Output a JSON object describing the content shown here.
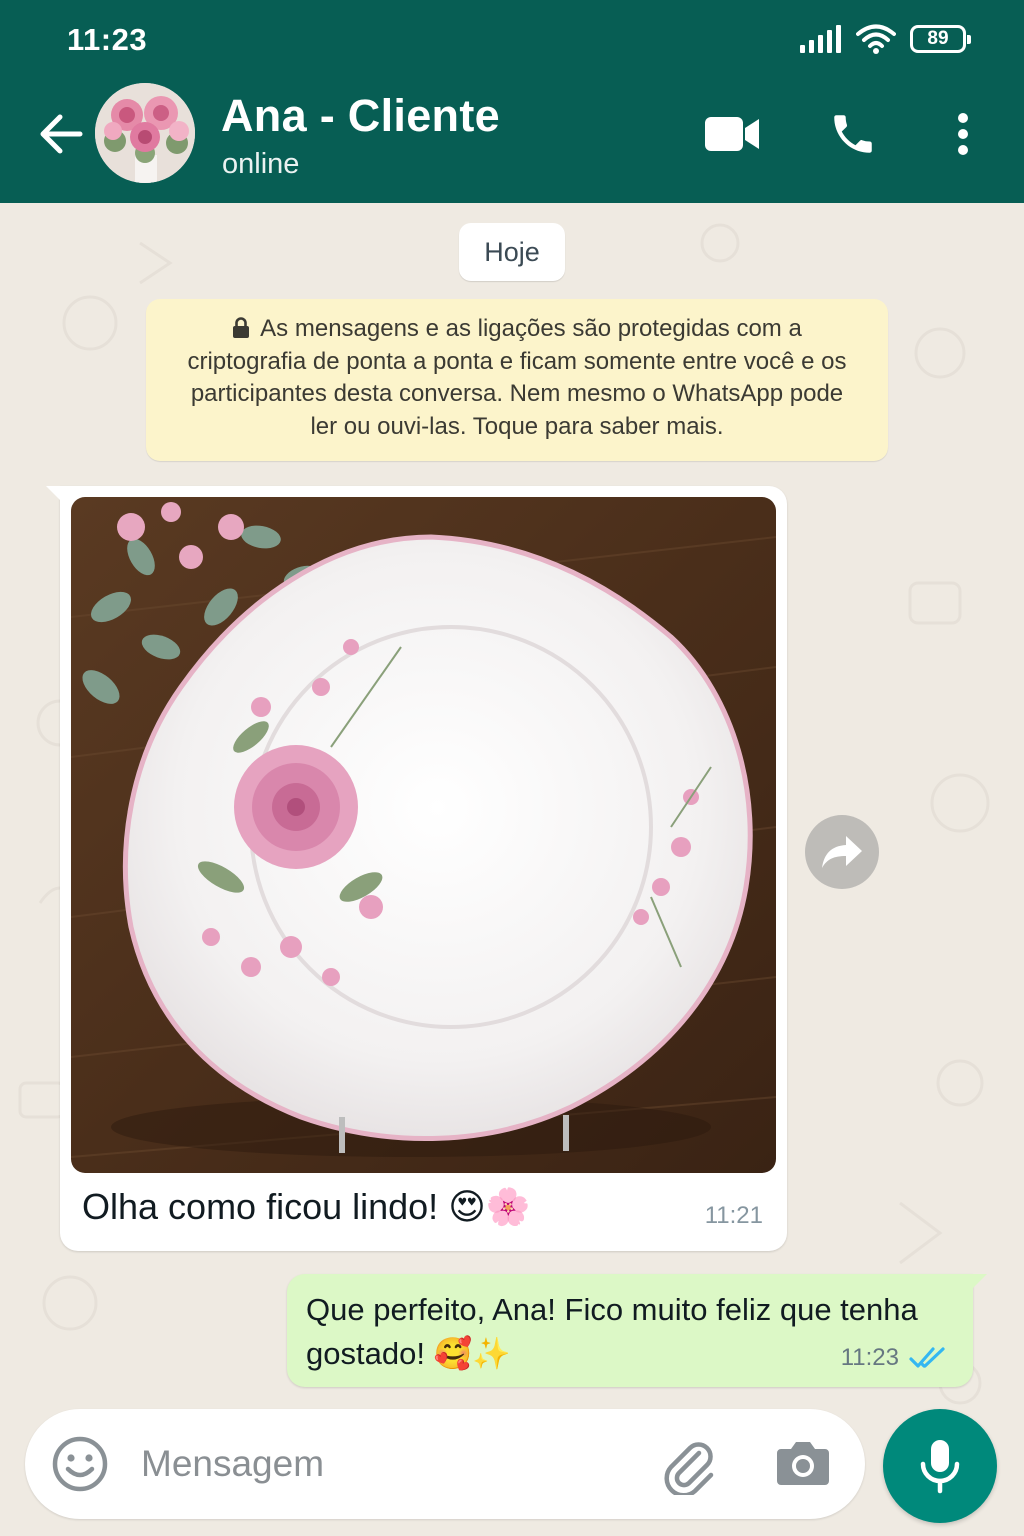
{
  "status_bar": {
    "time": "11:23",
    "battery": "89"
  },
  "header": {
    "contact_name": "Ana - Cliente",
    "contact_status": "online",
    "icons": [
      "back-arrow-icon",
      "video-call-icon",
      "phone-icon",
      "more-vert-icon"
    ]
  },
  "chat": {
    "date_chip": "Hoje",
    "encryption_notice": "As mensagens e as ligações são protegidas com a criptografia de ponta a ponta e ficam somente entre você e os participantes desta conversa. Nem mesmo o WhatsApp pode ler ou ouvi-las. Toque para saber mais.",
    "messages": [
      {
        "direction": "incoming",
        "type": "image",
        "image_description": "white scalloped porcelain plate with pink floral pattern on wooden table",
        "text": "Olha como ficou lindo! 😍🌸",
        "time": "11:21"
      },
      {
        "direction": "outgoing",
        "type": "text",
        "text": "Que perfeito, Ana! Fico muito feliz que tenha gostado! 🥰✨",
        "time": "11:23",
        "read": true
      }
    ]
  },
  "composer": {
    "placeholder": "Mensagem"
  },
  "colors": {
    "header": "#075e54",
    "chat_background": "#efeae2",
    "outgoing_bubble": "#dcf8c6",
    "notice": "#fcf4cb",
    "read_ticks": "#34b7f1",
    "mic_button": "#00897b"
  }
}
